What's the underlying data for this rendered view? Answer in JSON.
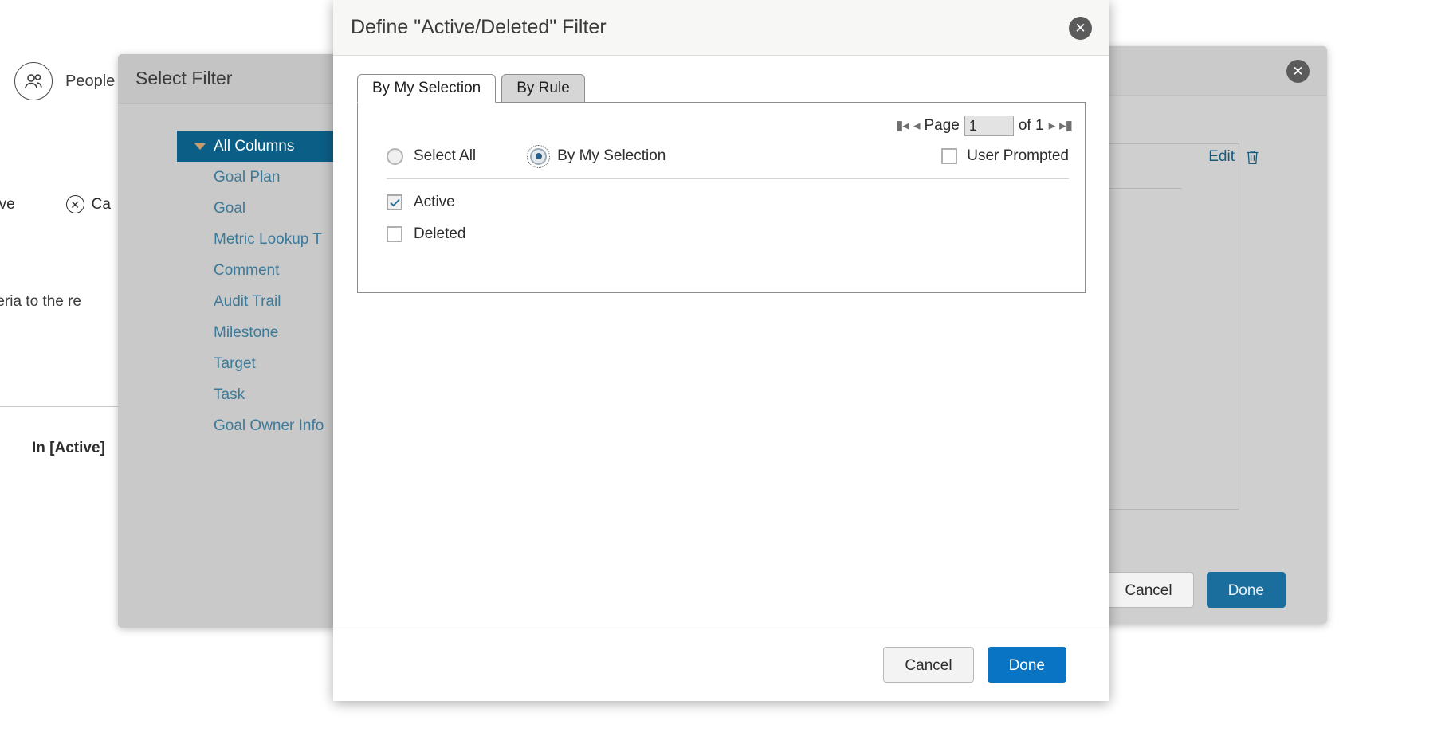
{
  "background": {
    "people_label": "People",
    "save_label": "ave",
    "cancel_label": "Ca",
    "criteria_text": "criteria to the re",
    "in_active_text": "In [Active]"
  },
  "outer_dialog": {
    "edit_label": "Edit",
    "cancel_label": "Cancel",
    "done_label": "Done"
  },
  "select_filter": {
    "title": "Select Filter",
    "tree": [
      {
        "label": "All Columns",
        "level": 0,
        "selected": true
      },
      {
        "label": "Goal Plan",
        "level": 1,
        "selected": false
      },
      {
        "label": "Goal",
        "level": 1,
        "selected": false
      },
      {
        "label": "Metric Lookup T",
        "level": 1,
        "selected": false
      },
      {
        "label": "Comment",
        "level": 1,
        "selected": false
      },
      {
        "label": "Audit Trail",
        "level": 1,
        "selected": false
      },
      {
        "label": "Milestone",
        "level": 1,
        "selected": false
      },
      {
        "label": "Target",
        "level": 1,
        "selected": false
      },
      {
        "label": "Task",
        "level": 1,
        "selected": false
      },
      {
        "label": "Goal Owner Info",
        "level": 1,
        "selected": false
      }
    ]
  },
  "define_modal": {
    "title": "Define \"Active/Deleted\" Filter",
    "tabs": [
      {
        "label": "By My Selection",
        "active": true
      },
      {
        "label": "By Rule",
        "active": false
      }
    ],
    "pager": {
      "first_icon": "first-page-icon",
      "prev_icon": "prev-page-icon",
      "page_label": "Page",
      "page_value": "1",
      "of_label": "of 1",
      "next_icon": "next-page-icon",
      "last_icon": "last-page-icon"
    },
    "options": {
      "select_all_label": "Select All",
      "select_all_checked": false,
      "by_my_selection_label": "By My Selection",
      "by_my_selection_checked": true,
      "user_prompted_label": "User Prompted",
      "user_prompted_checked": false
    },
    "items": [
      {
        "label": "Active",
        "checked": true
      },
      {
        "label": "Deleted",
        "checked": false
      }
    ],
    "footer": {
      "cancel_label": "Cancel",
      "done_label": "Done"
    }
  },
  "colors": {
    "accent_blue": "#0a74c4",
    "tree_selected": "#0b5e86",
    "link_blue": "#3d7a99",
    "edit_link": "#175a7a"
  }
}
